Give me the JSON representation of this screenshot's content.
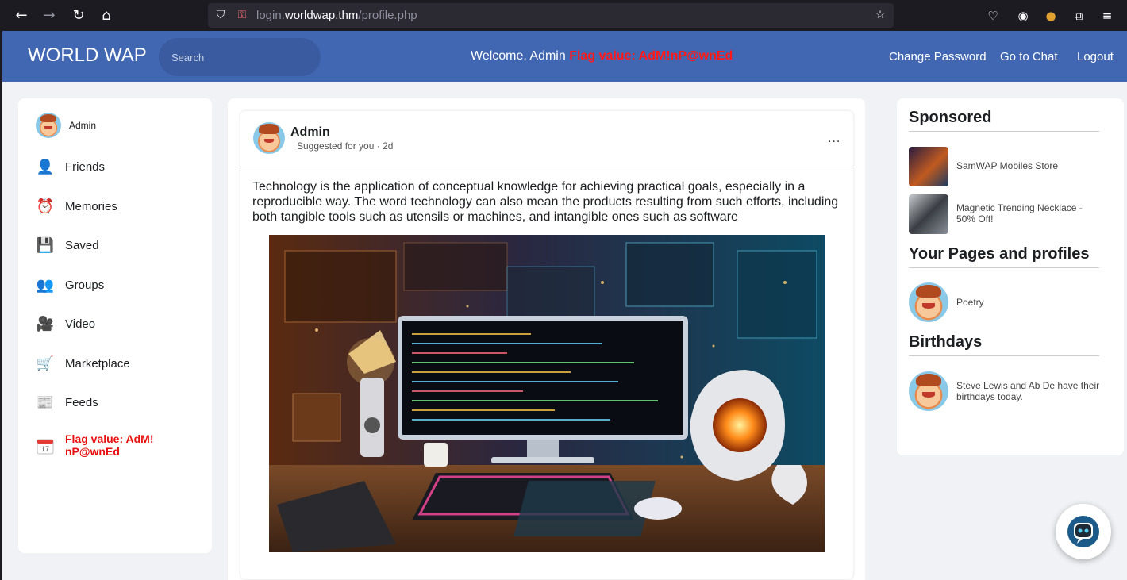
{
  "browser": {
    "url_prefix": "login.",
    "url_host": "worldwap.thm",
    "url_path": "/profile.php"
  },
  "header": {
    "logo": "WORLD WAP",
    "search_placeholder": "Search",
    "welcome": "Welcome, Admin",
    "flag_text": "Flag value: AdM!nP@wnEd",
    "links": {
      "change_password": "Change Password",
      "go_to_chat": "Go to Chat",
      "logout": "Logout"
    }
  },
  "sidebar": {
    "profile_name": "Admin",
    "items": [
      {
        "label": "Friends",
        "icon": "friends-icon"
      },
      {
        "label": "Memories",
        "icon": "memories-icon"
      },
      {
        "label": "Saved",
        "icon": "saved-icon"
      },
      {
        "label": "Groups",
        "icon": "groups-icon"
      },
      {
        "label": "Video",
        "icon": "video-icon"
      },
      {
        "label": "Marketplace",
        "icon": "marketplace-icon"
      },
      {
        "label": "Feeds",
        "icon": "feeds-icon"
      }
    ],
    "flag_line1": "Flag value: AdM!",
    "flag_line2": "nP@wnEd",
    "calendar_day": "17"
  },
  "post": {
    "author": "Admin",
    "meta": "Suggested for you · 2d",
    "more": "...",
    "body": "Technology is the application of conceptual knowledge for achieving practical goals, especially in a reproducible way. The word technology can also mean the products resulting from such efforts, including both tangible tools such as utensils or machines, and intangible ones such as software"
  },
  "right": {
    "sponsored_title": "Sponsored",
    "sponsored": [
      {
        "label": "SamWAP Mobiles Store"
      },
      {
        "label": "Magnetic Trending Necklace - 50% Off!"
      }
    ],
    "pages_title": "Your Pages and profiles",
    "pages": [
      {
        "label": "Poetry"
      }
    ],
    "birthdays_title": "Birthdays",
    "birthday_text": "Steve Lewis and Ab De have their birthdays today."
  },
  "colors": {
    "topbar": "#4267b2",
    "flag": "#ff1a1a",
    "page_bg": "#f0f2f5"
  }
}
